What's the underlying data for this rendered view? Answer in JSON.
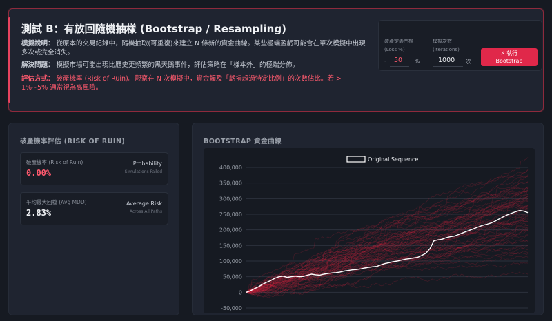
{
  "test": {
    "title": "測試 B：有放回隨機抽樣 (Bootstrap / Resampling)",
    "sim_label": "模擬說明：",
    "sim_text": "從原本的交易紀錄中，隨機抽取(可重複)來建立 N 條新的資金曲線。某些極端盈虧可能會在單次模擬中出現多次或完全消失。",
    "solve_label": "解決問題：",
    "solve_text": "模擬市場可能出現比歷史更頻繁的黑天鵝事件，評估策略在「樣本外」的極端分佈。",
    "eval_label": "評估方式：",
    "eval_text": "破產機率 (Risk of Ruin)。觀察在 N 次模擬中，資金觸及「虧損超過特定比例」的次數佔比。若 > 1%~5% 通常視為高風險。"
  },
  "controls": {
    "ruin_label_1": "破產定義門檻",
    "ruin_label_2": "(Loss %)",
    "ruin_prefix": "-",
    "ruin_value": "50",
    "ruin_unit": "%",
    "iter_label_1": "模擬次數",
    "iter_label_2": "(Iterations)",
    "iter_value": "1000",
    "iter_unit": "次",
    "run_icon": "⚡",
    "run_label_1": "執行",
    "run_label_2": "Bootstrap"
  },
  "risk": {
    "title": "破產機率評估 (RISK OF RUIN)",
    "metrics": [
      {
        "label": "破產機率 (Risk of Ruin)",
        "value": "0.00%",
        "side": "Probability",
        "sub": "Simulations Failed",
        "color": "#ff5a6e"
      },
      {
        "label": "平均最大回檔 (Avg MDD)",
        "value": "2.83%",
        "side": "Average Risk",
        "sub": "Across All Paths",
        "color": "#f0f2f5"
      }
    ]
  },
  "chart_panel": {
    "title": "BOOTSTRAP 資金曲線"
  },
  "chart_data": {
    "type": "line",
    "legend": [
      "Original Sequence"
    ],
    "legend_position": "top-center",
    "y_ticks": [
      "400,000",
      "350,000",
      "300,000",
      "250,000",
      "200,000",
      "150,000",
      "100,000",
      "50,000",
      "0",
      "-50,000"
    ],
    "ylim": [
      -50000,
      400000
    ],
    "xlim": [
      0,
      200
    ],
    "grid": true,
    "series": [
      {
        "name": "Original Sequence",
        "color": "#ffffff",
        "values": [
          0,
          5000,
          12000,
          18000,
          26000,
          32000,
          38000,
          45000,
          50000,
          52000,
          48000,
          50000,
          52000,
          50000,
          51000,
          55000,
          58000,
          56000,
          55000,
          58000,
          60000,
          62000,
          63000,
          65000,
          68000,
          70000,
          72000,
          73000,
          75000,
          78000,
          80000,
          82000,
          83000,
          88000,
          92000,
          95000,
          98000,
          100000,
          103000,
          106000,
          108000,
          110000,
          112000,
          118000,
          125000,
          140000,
          165000,
          168000,
          170000,
          175000,
          178000,
          180000,
          185000,
          190000,
          195000,
          200000,
          205000,
          210000,
          215000,
          218000,
          222000,
          228000,
          235000,
          242000,
          248000,
          253000,
          258000,
          262000,
          260000,
          255000
        ]
      }
    ],
    "bootstrap_paths": 1000,
    "bootstrap_color": "#d8243f"
  },
  "colors": {
    "accent": "#e8435f",
    "button": "#e0284a",
    "background": "#161a22",
    "panel": "#1f2430"
  }
}
